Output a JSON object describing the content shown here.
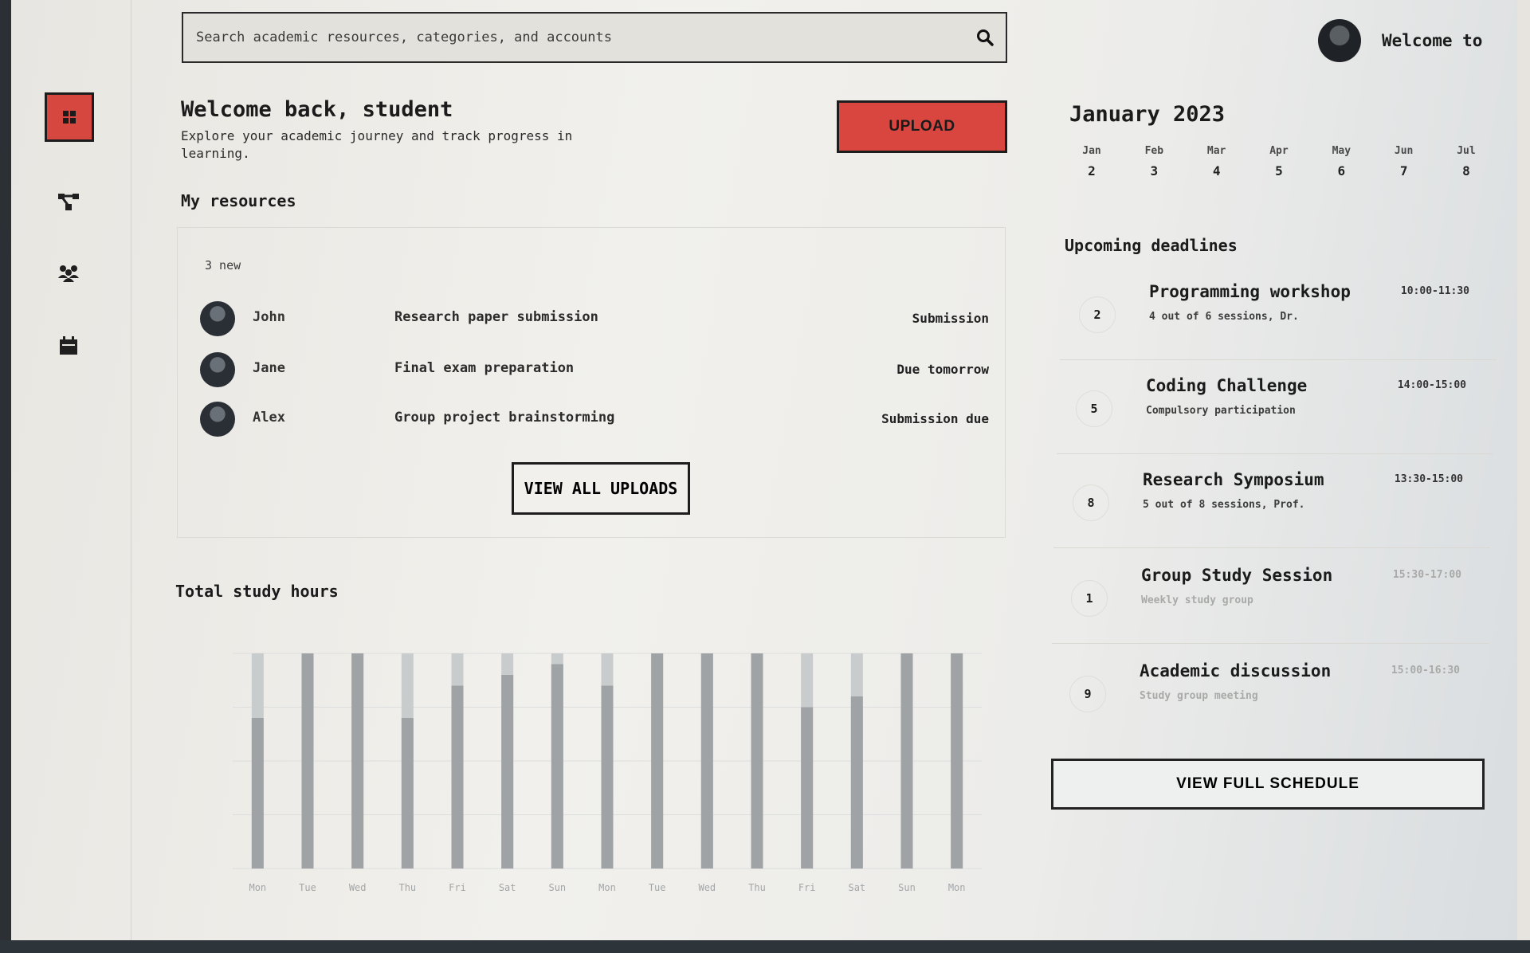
{
  "search": {
    "placeholder": "Search academic resources, categories, and accounts"
  },
  "user": {
    "greeting": "Welcome to"
  },
  "sidebar": {
    "items": [
      {
        "icon": "dashboard-icon",
        "active": true
      },
      {
        "icon": "network-icon",
        "active": false
      },
      {
        "icon": "group-icon",
        "active": false
      },
      {
        "icon": "calendar-icon",
        "active": false
      }
    ]
  },
  "welcome": {
    "title": "Welcome back, student",
    "subtitle": "Explore your academic journey and track progress in learning."
  },
  "upload_label": "UPLOAD",
  "resources": {
    "title": "My resources",
    "new_count": "3 new",
    "rows": [
      {
        "name": "John",
        "title": "Research paper submission",
        "status": "Submission"
      },
      {
        "name": "Jane",
        "title": "Final exam preparation",
        "status": "Due tomorrow"
      },
      {
        "name": "Alex",
        "title": "Group project brainstorming",
        "status": "Submission due"
      }
    ],
    "view_all_label": "VIEW ALL UPLOADS"
  },
  "chart_title": "Total study hours",
  "chart_data": {
    "type": "bar",
    "categories": [
      "Mon",
      "Tue",
      "Wed",
      "Thu",
      "Fri",
      "Sat",
      "Sun",
      "Mon",
      "Tue",
      "Wed",
      "Thu",
      "Fri",
      "Sat",
      "Sun",
      "Mon"
    ],
    "series": [
      {
        "values": [
          7,
          10,
          10,
          7,
          8.5,
          9,
          9.5,
          8.5,
          10,
          10,
          10,
          7.5,
          8,
          10,
          10
        ]
      }
    ],
    "ylim": [
      0,
      10
    ],
    "grid": true,
    "colors": {
      "bar": "#9fa3a6",
      "track": "#c9cccd"
    }
  },
  "calendar": {
    "title": "January 2023",
    "months": [
      {
        "m": "Jan",
        "d": "2"
      },
      {
        "m": "Feb",
        "d": "3"
      },
      {
        "m": "Mar",
        "d": "4"
      },
      {
        "m": "Apr",
        "d": "5"
      },
      {
        "m": "May",
        "d": "6"
      },
      {
        "m": "Jun",
        "d": "7"
      },
      {
        "m": "Jul",
        "d": "8"
      }
    ]
  },
  "deadlines": {
    "title": "Upcoming deadlines",
    "items": [
      {
        "num": "2",
        "title": "Programming workshop",
        "sub": "4 out of 6 sessions, Dr.",
        "time": "10:00-11:30"
      },
      {
        "num": "5",
        "title": "Coding Challenge",
        "sub": "Compulsory participation",
        "time": "14:00-15:00"
      },
      {
        "num": "8",
        "title": "Research Symposium",
        "sub": "5 out of 8 sessions, Prof.",
        "time": "13:30-15:00"
      },
      {
        "num": "1",
        "title": "Group Study Session",
        "sub": "Weekly study group",
        "time": "15:30-17:00"
      },
      {
        "num": "9",
        "title": "Academic discussion",
        "sub": "Study group meeting",
        "time": "15:00-16:30"
      }
    ],
    "view_full_label": "VIEW FULL SCHEDULE"
  },
  "colors": {
    "accent": "#d8463f",
    "text": "#1b1b1b",
    "background": "#efeeea"
  }
}
